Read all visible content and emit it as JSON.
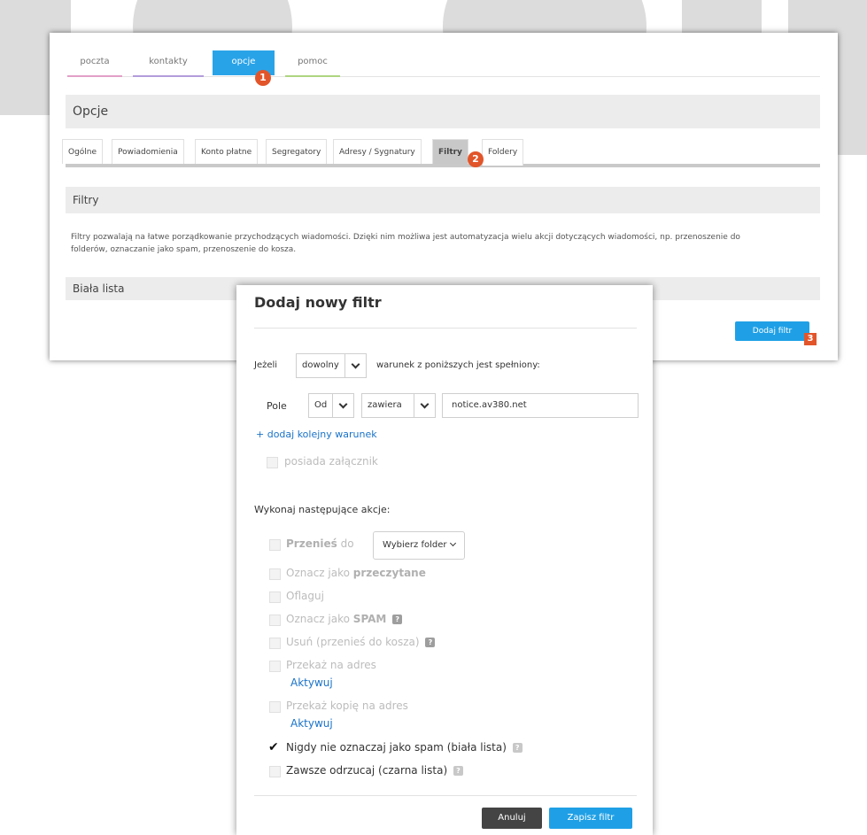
{
  "nav": {
    "tabs": [
      {
        "label": "poczta",
        "color": "#e3a0c8"
      },
      {
        "label": "kontakty",
        "color": "#b39ddb"
      },
      {
        "label": "opcje",
        "color": "#29a3e8"
      },
      {
        "label": "pomoc",
        "color": "#aed581"
      }
    ],
    "active": "opcje"
  },
  "markers": {
    "one": "1",
    "two": "2",
    "three": "3"
  },
  "options": {
    "title": "Opcje",
    "subtabs": [
      "Ogólne",
      "Powiadomienia",
      "Konto płatne",
      "Segregatory",
      "Adresy / Sygnatury",
      "Filtry",
      "Foldery"
    ],
    "active_subtab": "Filtry"
  },
  "filters": {
    "title": "Filtry",
    "description": "Filtry pozwalają na łatwe porządkowanie przychodzących wiadomości. Dzięki nim możliwa jest automatyzacja wielu akcji dotyczących wiadomości, np. przenoszenie do folderów, oznaczanie jako spam, przenoszenie do kosza.",
    "whitelist_title": "Biała lista",
    "add_button": "Dodaj filtr"
  },
  "modal": {
    "title": "Dodaj nowy filtr",
    "if_label": "Jeżeli",
    "match_select": "dowolny",
    "condition_text": "warunek z poniższych jest spełniony:",
    "field_label": "Pole",
    "field_select": "Od",
    "op_select": "zawiera",
    "value": "notice.av380.net",
    "add_condition": "+ dodaj kolejny warunek",
    "has_attachment": "posiada załącznik",
    "actions_title": "Wykonaj następujące akcje:",
    "move_bold": "Przenieś",
    "move_rest": "do",
    "folder_select": "Wybierz folder",
    "mark_read_prefix": "Oznacz jako",
    "mark_read_bold": "przeczytane",
    "flag": "Oflaguj",
    "spam_prefix": "Oznacz jako",
    "spam_bold": "SPAM",
    "delete": "Usuń (przenieś do kosza)",
    "forward": "Przekaż na adres",
    "activate_1": "Aktywuj",
    "forward_copy": "Przekaż kopię na adres",
    "activate_2": "Aktywuj",
    "never_spam": "Nigdy nie oznaczaj jako spam (biała lista)",
    "always_reject": "Zawsze odrzucaj (czarna lista)",
    "help_glyph": "?",
    "cancel_button": "Anuluj",
    "save_button": "Zapisz filtr"
  },
  "colors": {
    "accent": "#1fa0e6",
    "badge": "#e2552a",
    "cancel": "#444444"
  }
}
